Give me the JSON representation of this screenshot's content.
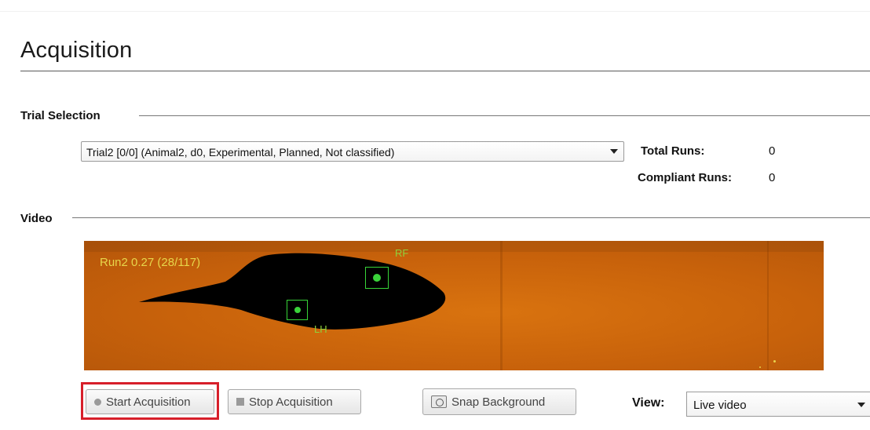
{
  "page": {
    "title": "Acquisition"
  },
  "trial_selection": {
    "section_label": "Trial Selection",
    "selected_trial": "Trial2 [0/0] (Animal2, d0, Experimental, Planned, Not classified)",
    "total_runs_label": "Total Runs:",
    "total_runs_value": "0",
    "compliant_runs_label": "Compliant Runs:",
    "compliant_runs_value": "0"
  },
  "video": {
    "section_label": "Video",
    "overlay_run_text": "Run2 0.27 (28/117)",
    "paw_labels": {
      "rf": "RF",
      "lh": "LH"
    }
  },
  "controls": {
    "start_label": "Start Acquisition",
    "stop_label": "Stop Acquisition",
    "snap_label": "Snap Background",
    "view_label": "View:",
    "view_value": "Live video"
  },
  "colors": {
    "highlight": "#d71f2a",
    "video_background": "#c8620b",
    "tracking_box": "#38d438",
    "overlay_text": "#e7d64a"
  },
  "icons": {
    "start": "record-circle-icon",
    "stop": "stop-square-icon",
    "snap": "camera-icon",
    "dropdown": "dropdown-arrow-icon"
  }
}
